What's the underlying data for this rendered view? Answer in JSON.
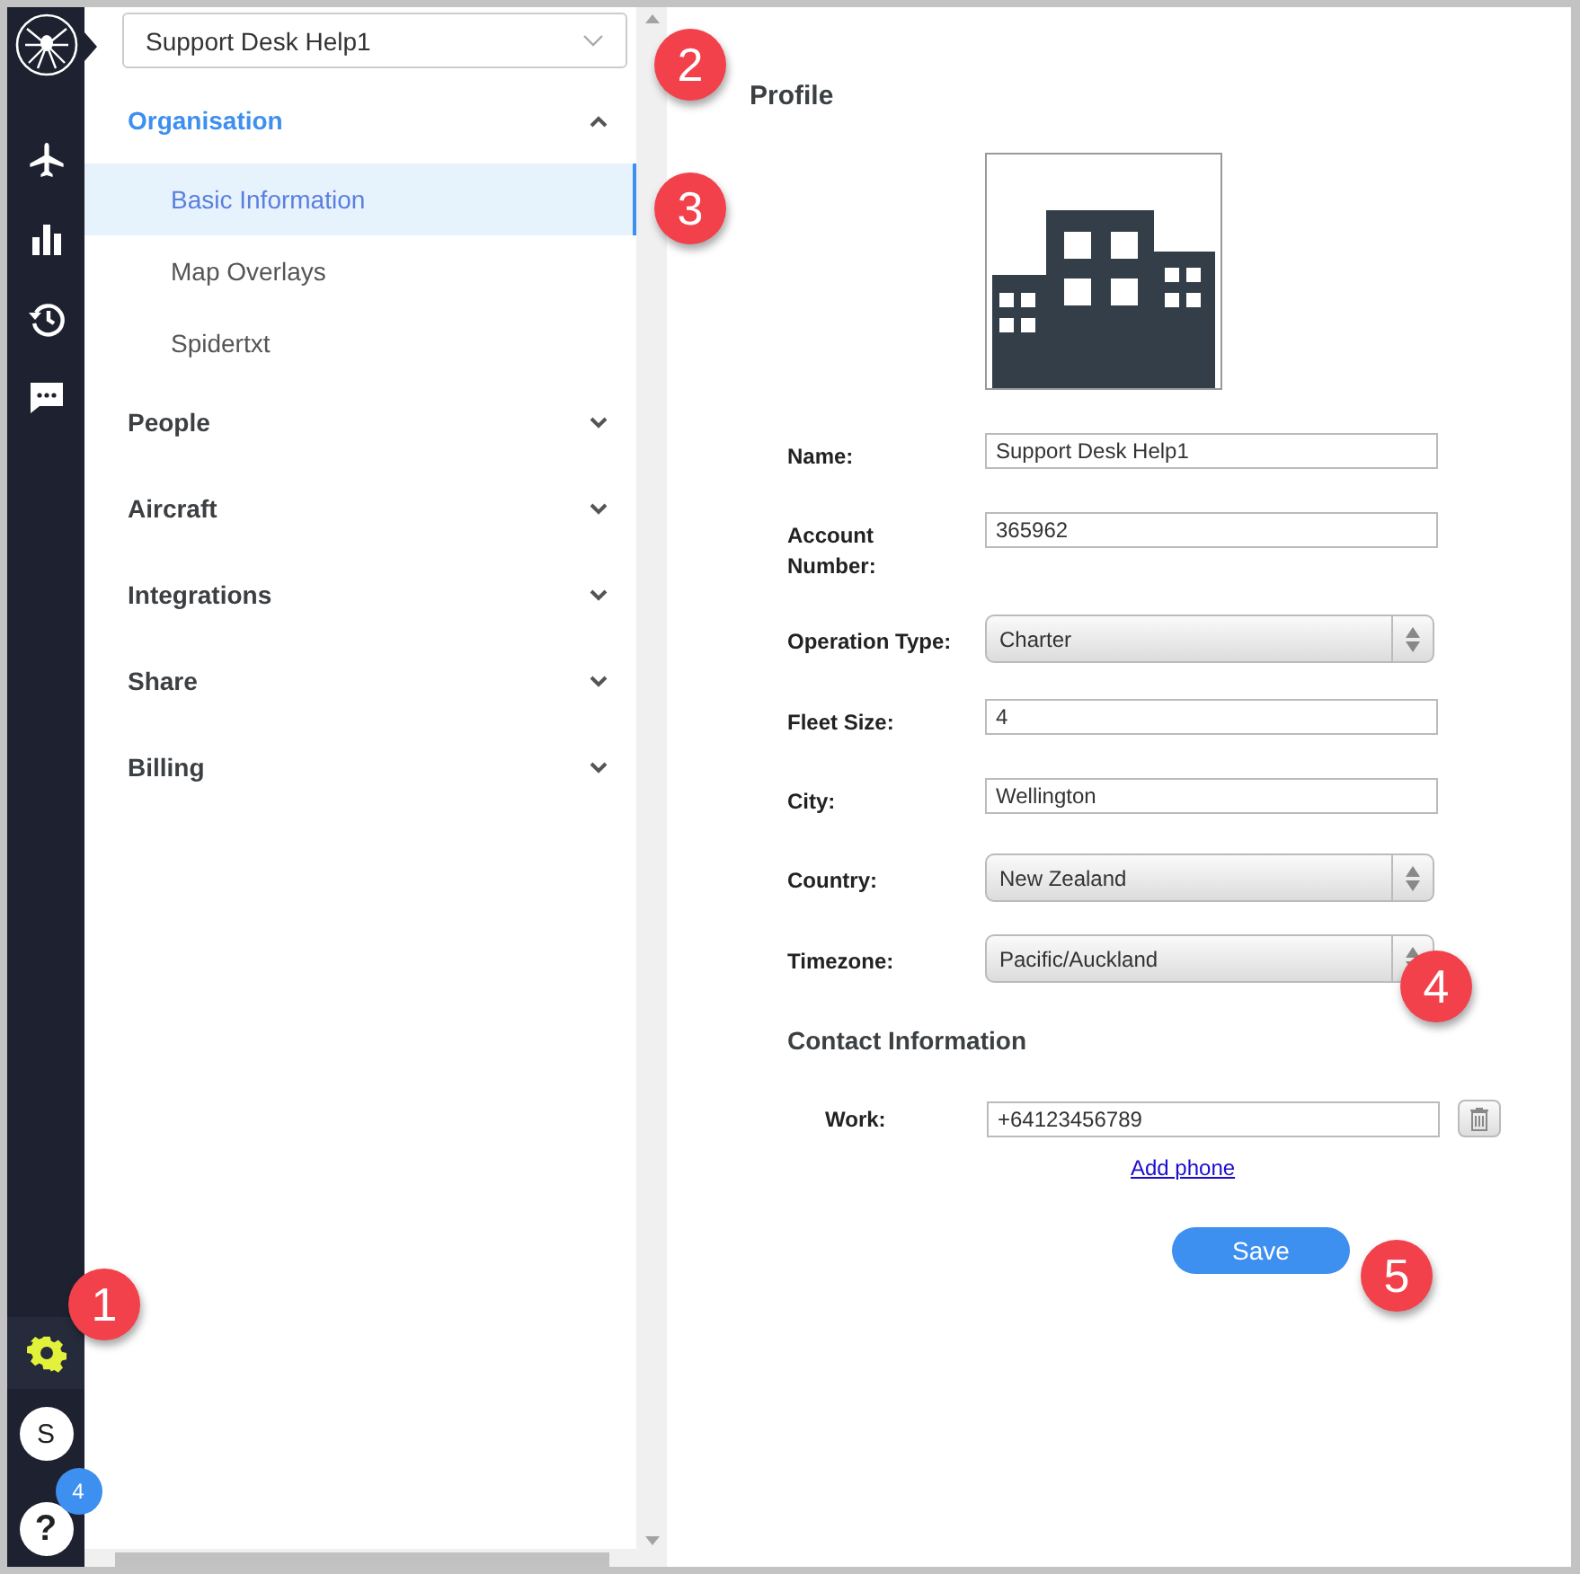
{
  "rail": {
    "items": [
      {
        "kind": "plane",
        "selected": false
      },
      {
        "kind": "chart",
        "selected": false
      },
      {
        "kind": "history",
        "selected": false
      },
      {
        "kind": "chat",
        "selected": false
      }
    ],
    "settings": {
      "selected": true
    },
    "avatar": "S",
    "help": {
      "label": "?",
      "badge": "4"
    }
  },
  "nav": {
    "org_select": "Support Desk Help1",
    "sections": [
      {
        "label": "Organisation",
        "expanded": true,
        "children": [
          {
            "label": "Basic Information",
            "selected": true
          },
          {
            "label": "Map Overlays",
            "selected": false
          },
          {
            "label": "Spidertxt",
            "selected": false
          }
        ]
      },
      {
        "label": "People",
        "expanded": false
      },
      {
        "label": "Aircraft",
        "expanded": false
      },
      {
        "label": "Integrations",
        "expanded": false
      },
      {
        "label": "Share",
        "expanded": false
      },
      {
        "label": "Billing",
        "expanded": false
      }
    ]
  },
  "profile": {
    "title": "Profile",
    "fields": [
      {
        "label": "Name:",
        "kind": "text",
        "value": "Support Desk Help1"
      },
      {
        "label": "Account Number:",
        "kind": "text",
        "value": "365962"
      },
      {
        "label": "Operation Type:",
        "kind": "select",
        "value": "Charter"
      },
      {
        "label": "Fleet Size:",
        "kind": "text",
        "value": "4"
      },
      {
        "label": "City:",
        "kind": "text",
        "value": "Wellington"
      },
      {
        "label": "Country:",
        "kind": "select",
        "value": "New Zealand"
      },
      {
        "label": "Timezone:",
        "kind": "select",
        "value": "Pacific/Auckland"
      }
    ],
    "contact_title": "Contact Information",
    "phones": [
      {
        "label": "Work:",
        "value": "+64123456789"
      }
    ],
    "add_phone": "Add phone",
    "save": "Save"
  },
  "callouts": [
    "1",
    "2",
    "3",
    "4",
    "5"
  ]
}
